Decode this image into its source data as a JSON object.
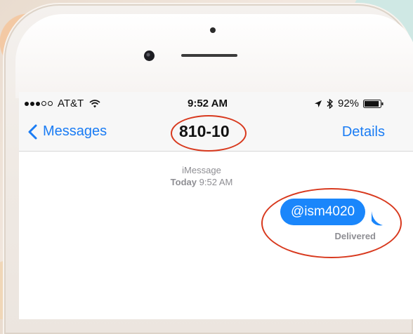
{
  "status_bar": {
    "signal_dots": [
      "full",
      "full",
      "full",
      "empty",
      "empty"
    ],
    "carrier": "AT&T",
    "wifi_icon": "wifi-icon",
    "time": "9:52 AM",
    "location_icon": "location-arrow-icon",
    "bluetooth_icon": "bluetooth-icon",
    "battery_percent": "92%",
    "battery_level": 0.92
  },
  "nav": {
    "back_label": "Messages",
    "title": "810-10",
    "details_label": "Details"
  },
  "conversation": {
    "service": "iMessage",
    "day": "Today",
    "time": "9:52 AM",
    "message": "@ism4020",
    "status": "Delivered"
  },
  "colors": {
    "accent": "#1a7cf4",
    "bubble": "#1a86fb",
    "annotation": "#d8391e"
  }
}
